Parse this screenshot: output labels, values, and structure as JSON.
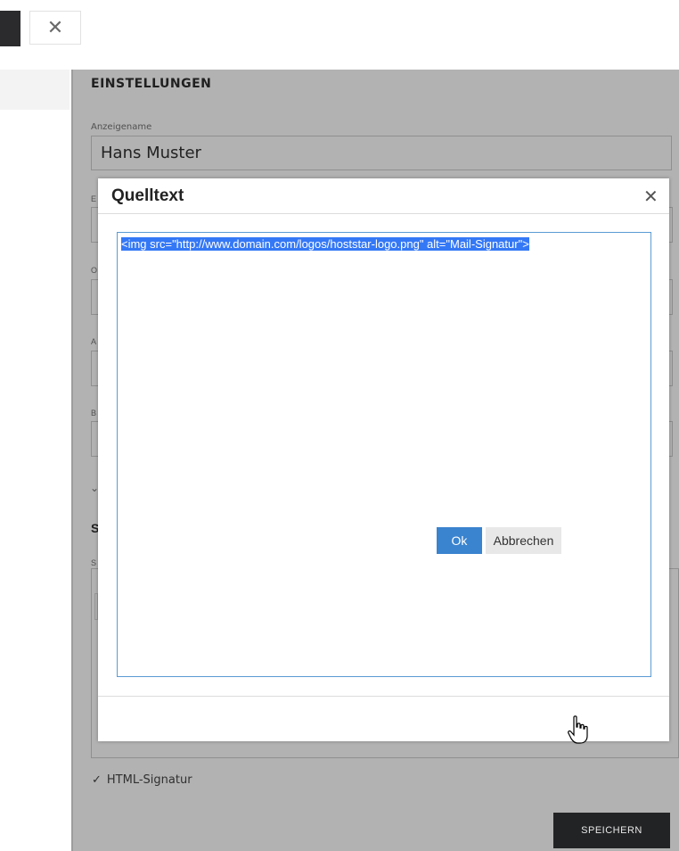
{
  "topbar": {
    "close_icon": "close-icon"
  },
  "settings": {
    "section_title": "EINSTELLUNGEN",
    "display_name_label": "Anzeigename",
    "display_name_value": "Hans Muster",
    "html_signature_label": "HTML-Signatur",
    "save_label": "SPEICHERN"
  },
  "modal": {
    "title": "Quelltext",
    "source_code": "<img src=\"http://www.domain.com/logos/hoststar-logo.png\" alt=\"Mail-Signatur\">",
    "ok_label": "Ok",
    "cancel_label": "Abbrechen"
  },
  "colors": {
    "accent": "#3a83cf",
    "selection": "#3478f6",
    "overlay": "#b2b2b2",
    "dark": "#222325"
  }
}
